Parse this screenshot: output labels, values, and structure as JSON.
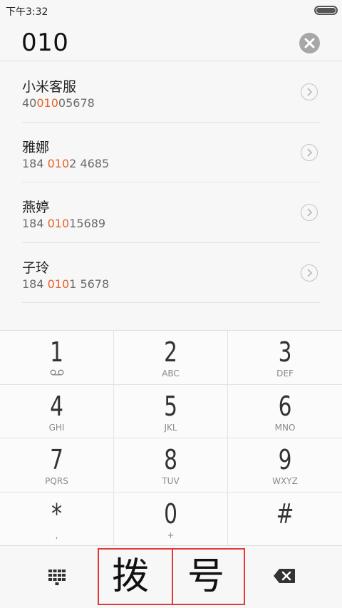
{
  "status_bar": {
    "time": "下午3:32",
    "battery_level": 1.0
  },
  "search": {
    "query": "010",
    "clear_icon": "clear-icon"
  },
  "results": [
    {
      "name": "小米客服",
      "num_pre": "40",
      "num_hl": "010",
      "num_post": "05678"
    },
    {
      "name": "雅娜",
      "num_pre": "184 ",
      "num_hl": "010",
      "num_post": "2 4685"
    },
    {
      "name": "燕婷",
      "num_pre": "184 ",
      "num_hl": "010",
      "num_post": "15689"
    },
    {
      "name": "子玲",
      "num_pre": "184 ",
      "num_hl": "010",
      "num_post": "1 5678"
    }
  ],
  "keypad": [
    {
      "digit": "1",
      "letters": ""
    },
    {
      "digit": "2",
      "letters": "ABC"
    },
    {
      "digit": "3",
      "letters": "DEF"
    },
    {
      "digit": "4",
      "letters": "GHI"
    },
    {
      "digit": "5",
      "letters": "JKL"
    },
    {
      "digit": "6",
      "letters": "MNO"
    },
    {
      "digit": "7",
      "letters": "PQRS"
    },
    {
      "digit": "8",
      "letters": "TUV"
    },
    {
      "digit": "9",
      "letters": "WXYZ"
    },
    {
      "digit": "*",
      "letters": ","
    },
    {
      "digit": "0",
      "letters": "+"
    },
    {
      "digit": "#",
      "letters": ""
    }
  ],
  "bottom": {
    "call_char_1": "拨",
    "call_char_2": "号"
  },
  "colors": {
    "highlight": "#e8622a",
    "call_border": "#e03a3a"
  }
}
